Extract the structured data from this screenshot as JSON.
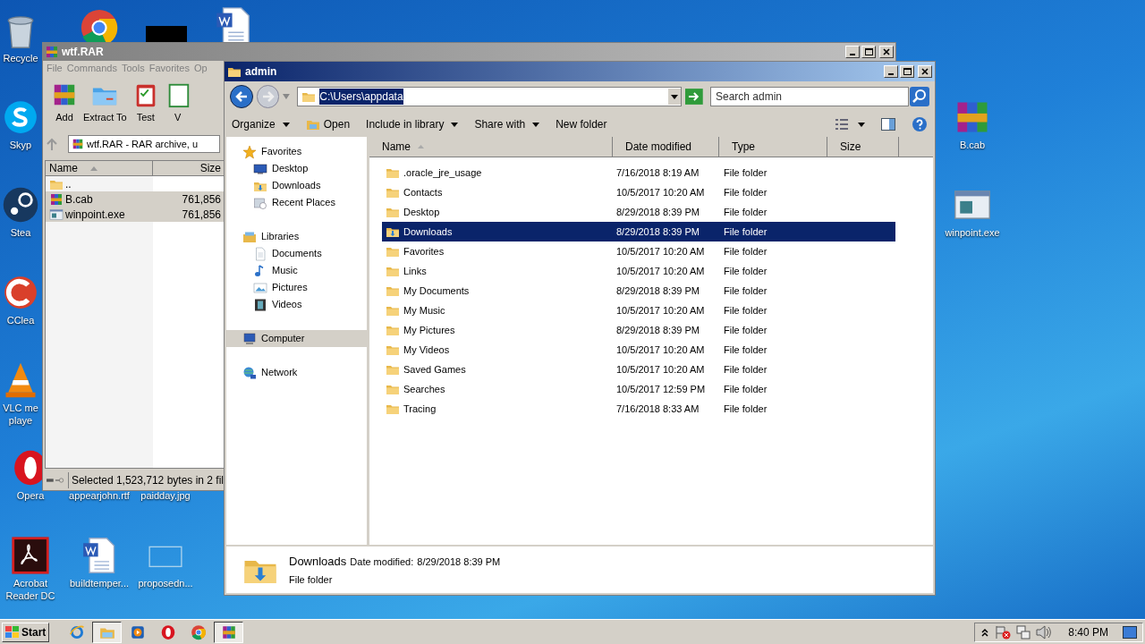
{
  "desktop_icons": [
    {
      "label": "Recycle",
      "kind": "recycle"
    },
    {
      "label": "Skyp",
      "kind": "skype"
    },
    {
      "label": "Stea",
      "kind": "steam"
    },
    {
      "label": "CClea",
      "kind": "ccleaner"
    },
    {
      "label": "VLC me\nplaye",
      "kind": "vlc"
    },
    {
      "label": "Opera",
      "kind": "opera"
    },
    {
      "label": "Acrobat\nReader DC",
      "kind": "acrobat"
    },
    {
      "label": "appearjohn.rtf",
      "kind": "none"
    },
    {
      "label": "paidday.jpg",
      "kind": "none"
    },
    {
      "label": "buildtemper...",
      "kind": "word"
    },
    {
      "label": "proposedn...",
      "kind": "frame"
    },
    {
      "label": "B.cab",
      "kind": "winrar"
    },
    {
      "label": "winpoint.exe",
      "kind": "exe"
    }
  ],
  "winrar": {
    "title": "wtf.RAR",
    "menus": [
      "File",
      "Commands",
      "Tools",
      "Favorites",
      "Op"
    ],
    "tools": [
      {
        "label": "Add",
        "kind": "winrar"
      },
      {
        "label": "Extract To",
        "kind": "extract"
      },
      {
        "label": "Test",
        "kind": "test"
      },
      {
        "label": "V",
        "kind": "view"
      }
    ],
    "address": "wtf.RAR - RAR archive, u",
    "columns": [
      "Name",
      "Size"
    ],
    "rows": [
      {
        "name": "..",
        "size": "",
        "kind": "folder",
        "selected": false
      },
      {
        "name": "B.cab",
        "size": "761,856",
        "kind": "winrar",
        "selected": true
      },
      {
        "name": "winpoint.exe",
        "size": "761,856",
        "kind": "exe",
        "selected": true
      }
    ],
    "status": "Selected 1,523,712 bytes in 2 fil"
  },
  "explorer": {
    "title": "admin",
    "address": "C:\\Users\\appdata",
    "address_selected": true,
    "search_placeholder": "Search admin",
    "toolbar": [
      {
        "label": "Organize",
        "dropdown": true,
        "kind": "none"
      },
      {
        "label": "Open",
        "dropdown": false,
        "kind": "open"
      },
      {
        "label": "Include in library",
        "dropdown": true,
        "kind": "none"
      },
      {
        "label": "Share with",
        "dropdown": true,
        "kind": "none"
      },
      {
        "label": "New folder",
        "dropdown": false,
        "kind": "none"
      }
    ],
    "nav": [
      {
        "label": "Favorites",
        "kind": "star",
        "selected": false,
        "children": [
          {
            "label": "Desktop",
            "kind": "desktop",
            "selected": false
          },
          {
            "label": "Downloads",
            "kind": "downloads",
            "selected": false
          },
          {
            "label": "Recent Places",
            "kind": "recent",
            "selected": false
          }
        ]
      },
      {
        "label": "Libraries",
        "kind": "libraries",
        "selected": false,
        "children": [
          {
            "label": "Documents",
            "kind": "documents",
            "selected": false
          },
          {
            "label": "Music",
            "kind": "music",
            "selected": false
          },
          {
            "label": "Pictures",
            "kind": "pictures",
            "selected": false
          },
          {
            "label": "Videos",
            "kind": "videos",
            "selected": false
          }
        ]
      },
      {
        "label": "Computer",
        "kind": "computer",
        "selected": true
      },
      {
        "label": "Network",
        "kind": "network",
        "selected": false
      }
    ],
    "columns": [
      "Name",
      "Date modified",
      "Type",
      "Size"
    ],
    "rows": [
      {
        "name": ".oracle_jre_usage",
        "date": "7/16/2018 8:19 AM",
        "type": "File folder",
        "selected": false
      },
      {
        "name": "Contacts",
        "date": "10/5/2017 10:20 AM",
        "type": "File folder",
        "selected": false
      },
      {
        "name": "Desktop",
        "date": "8/29/2018 8:39 PM",
        "type": "File folder",
        "selected": false
      },
      {
        "name": "Downloads",
        "date": "8/29/2018 8:39 PM",
        "type": "File folder",
        "selected": true
      },
      {
        "name": "Favorites",
        "date": "10/5/2017 10:20 AM",
        "type": "File folder",
        "selected": false
      },
      {
        "name": "Links",
        "date": "10/5/2017 10:20 AM",
        "type": "File folder",
        "selected": false
      },
      {
        "name": "My Documents",
        "date": "8/29/2018 8:39 PM",
        "type": "File folder",
        "selected": false
      },
      {
        "name": "My Music",
        "date": "10/5/2017 10:20 AM",
        "type": "File folder",
        "selected": false
      },
      {
        "name": "My Pictures",
        "date": "8/29/2018 8:39 PM",
        "type": "File folder",
        "selected": false
      },
      {
        "name": "My Videos",
        "date": "10/5/2017 10:20 AM",
        "type": "File folder",
        "selected": false
      },
      {
        "name": "Saved Games",
        "date": "10/5/2017 10:20 AM",
        "type": "File folder",
        "selected": false
      },
      {
        "name": "Searches",
        "date": "10/5/2017 12:59 PM",
        "type": "File folder",
        "selected": false
      },
      {
        "name": "Tracing",
        "date": "7/16/2018 8:33 AM",
        "type": "File folder",
        "selected": false
      }
    ],
    "details": {
      "name": "Downloads",
      "date_label": "Date modified:",
      "date": "8/29/2018 8:39 PM",
      "type": "File folder"
    }
  },
  "taskbar": {
    "start": "Start",
    "apps": [
      {
        "kind": "ie",
        "active": false
      },
      {
        "kind": "explorer",
        "active": true
      },
      {
        "kind": "media",
        "active": false
      },
      {
        "kind": "opera",
        "active": false
      },
      {
        "kind": "chrome",
        "active": false
      },
      {
        "kind": "winrar",
        "active": true
      }
    ],
    "time": "8:40 PM"
  }
}
